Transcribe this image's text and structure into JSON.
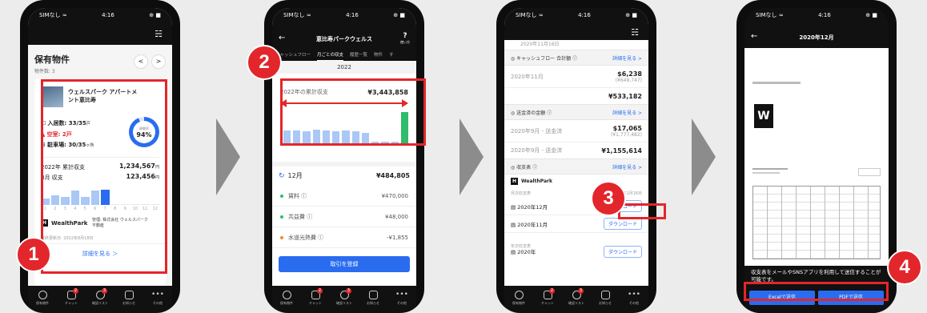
{
  "phone1": {
    "status": {
      "carrier": "SIMなし ≈",
      "time": "4:16",
      "battery": "⊕ ■"
    },
    "title": "保有物件",
    "count": "物件数: 3",
    "prop_name": "ウェルスパーク アパートメント恵比寿",
    "occupied": "入居数: 33/35",
    "occupied_unit": "戸",
    "vacant": "空室: 2戸",
    "parking": "駐車場: 30/35",
    "parking_unit": "ヶ所",
    "rate_label": "稼働率",
    "rate_value": "94%",
    "rate": 0.94,
    "annual_label": "2022年 累計収支",
    "annual_value": "1,234,567",
    "monthly_label": "8月 収支",
    "monthly_value": "123,456",
    "yen": "円",
    "bar_months": [
      "1",
      "2",
      "3",
      "4",
      "5",
      "6",
      "7",
      "8",
      "9",
      "10",
      "11",
      "12"
    ],
    "bars": [
      0.35,
      0.55,
      0.45,
      0.8,
      0.45,
      0.8,
      0.85,
      0,
      0,
      0,
      0,
      0
    ],
    "brand": "WealthPark",
    "manager": "管理: 株式会社 ウェルスパーク不動産",
    "updated": "最終更新日: 2022年8月18日",
    "detail": "詳細を見る",
    "prev": "<",
    "next": ">"
  },
  "phone2": {
    "status": {
      "carrier": "SIMなし ≈",
      "time": "4:16",
      "battery": "⊕ ■"
    },
    "title": "恵比寿パークウェルス",
    "help": "使い方",
    "tabs": [
      "キャッシュフロー",
      "月ごとの収支",
      "履歴一覧",
      "物件",
      "す"
    ],
    "year": "2022",
    "total_label": "2022年の累計収支",
    "total_value": "¥3,443,858",
    "bars": [
      0.45,
      0.45,
      0.42,
      0.48,
      0.45,
      0.42,
      0.45,
      0.42,
      0.38,
      0.12,
      0.12,
      0.12,
      1.0
    ],
    "month": "12月",
    "month_value": "¥484,805",
    "items": [
      {
        "label": "賃料 ⓘ",
        "value": "¥470,000",
        "color": "#2ebd6b"
      },
      {
        "label": "共益費 ⓘ",
        "value": "¥48,000",
        "color": "#2ebd6b"
      },
      {
        "label": "水道光熱費 ⓘ",
        "value": "-¥1,855",
        "color": "#f08a2e"
      }
    ],
    "register": "取引を登録"
  },
  "phone3": {
    "status": {
      "carrier": "SIMなし ≈",
      "time": "4:16",
      "battery": "⊕ ■"
    },
    "top_date": "2020年11月16日",
    "sections": [
      {
        "title": "キャッシュフロー 合計額 ⓘ",
        "link": "詳細を見る >",
        "rows": [
          {
            "label": "2020年11月",
            "value": "$6,238",
            "sub": "(¥649,747)"
          },
          {
            "label": "",
            "value": "¥533,182",
            "sub": ""
          }
        ]
      },
      {
        "title": "送金済の金額 ⓘ",
        "link": "詳細を見る >",
        "rows": [
          {
            "label": "2020年9月 - 送金済",
            "value": "$17,065",
            "sub": "(¥1,777,482)"
          },
          {
            "label": "2020年9月 - 送金済",
            "value": "¥1,155,614",
            "sub": ""
          }
        ]
      }
    ],
    "statement_title": "収支表 ⓘ",
    "statement_link": "詳細を見る >",
    "brand": "WealthPark",
    "monthly_header": "月次収支表",
    "updated": "2020年11月16日",
    "monthly": [
      {
        "label": "2020年12月",
        "btn": "ダウンロード"
      },
      {
        "label": "2020年11月",
        "btn": "ダウンロード"
      }
    ],
    "yearly_header": "年次収支表",
    "yearly": [
      {
        "label": "2020年",
        "btn": "ダウンロード"
      }
    ]
  },
  "phone4": {
    "status": {
      "carrier": "SIMなし ≈",
      "time": "4:16",
      "battery": "⊕ ■"
    },
    "title": "2020年12月",
    "note": "収支表をメールやSNSアプリを利用して送信することが可能です。",
    "excel": "Excelで送信",
    "pdf": "PDFで送信"
  },
  "tabbar": [
    "保有物件",
    "チャット",
    "確認リスト",
    "お知らせ",
    "その他"
  ],
  "tabbar_badges": [
    "",
    "2",
    "3",
    "",
    ""
  ],
  "badges": [
    "1",
    "2",
    "3",
    "4"
  ],
  "colors": {
    "accent": "#e3262b",
    "primary": "#2a6cf0",
    "bar": "#a9c8f5",
    "green": "#2ebd6b"
  }
}
